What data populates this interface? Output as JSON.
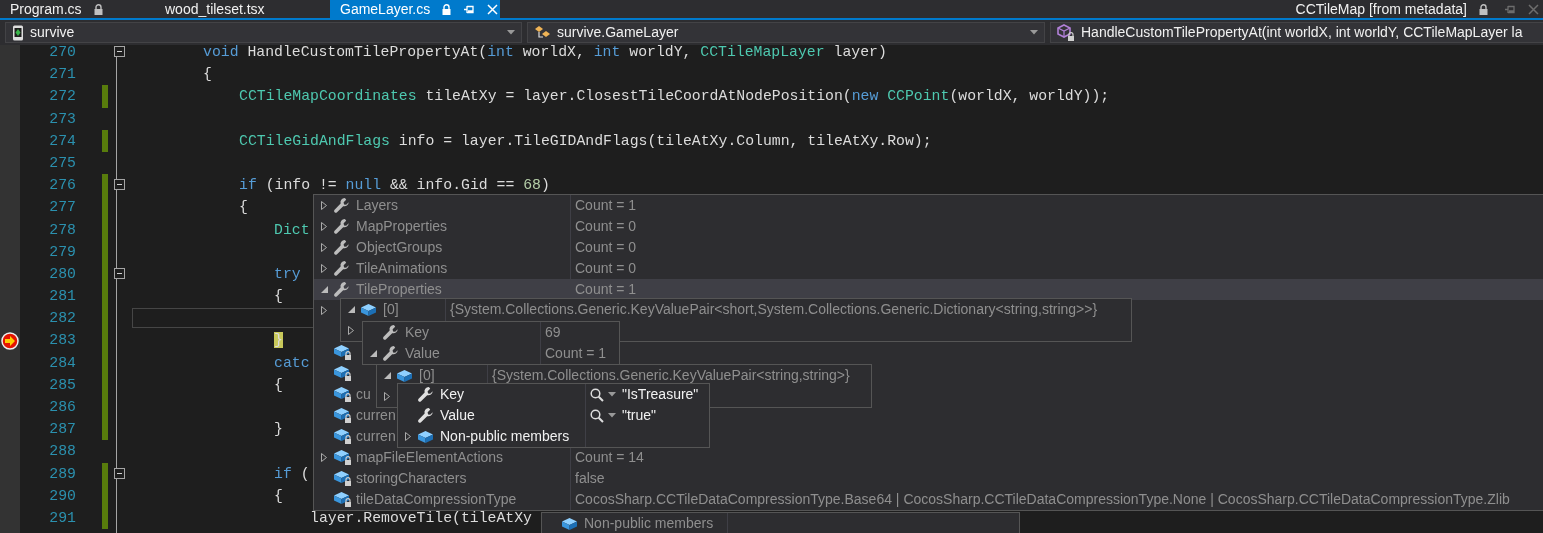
{
  "tabs": [
    {
      "label": "Program.cs",
      "kind": "doc",
      "selected": false,
      "locked": true
    },
    {
      "label": "wood_tileset.tsx",
      "kind": "doc",
      "selected": false,
      "locked": false
    },
    {
      "label": "GameLayer.cs",
      "kind": "doc",
      "selected": true,
      "locked": true
    },
    {
      "label": "CCTileMap [from metadata]",
      "kind": "preview",
      "selected": false,
      "locked": true
    }
  ],
  "navigation": {
    "project": "survive",
    "type": "survive.GameLayer",
    "member": "HandleCustomTilePropertyAt(int worldX, int worldY, CCTileMapLayer la"
  },
  "editor": {
    "lines": [
      {
        "number": "270",
        "changed": false,
        "foldable": true,
        "caret": false,
        "current_statement": false,
        "tokens": [
          {
            "text": "void",
            "kind": "keyword"
          },
          {
            "text": " HandleCustomTilePropertyAt(",
            "kind": "plain"
          },
          {
            "text": "int",
            "kind": "keyword"
          },
          {
            "text": " worldX, ",
            "kind": "plain"
          },
          {
            "text": "int",
            "kind": "keyword"
          },
          {
            "text": " worldY, ",
            "kind": "plain"
          },
          {
            "text": "CCTileMapLayer",
            "kind": "type"
          },
          {
            "text": " layer)",
            "kind": "plain"
          }
        ]
      },
      {
        "number": "271",
        "changed": false,
        "foldable": false,
        "caret": false,
        "current_statement": false,
        "tokens": [
          {
            "text": "{",
            "kind": "plain"
          }
        ],
        "children": [
          {
            "number": "272",
            "changed": true,
            "foldable": false,
            "caret": false,
            "current_statement": false,
            "tokens": [
              {
                "text": "CCTileMapCoordinates",
                "kind": "type"
              },
              {
                "text": " tileAtXy = layer.ClosestTileCoordAtNodePosition(",
                "kind": "plain"
              },
              {
                "text": "new",
                "kind": "keyword"
              },
              {
                "text": " CCPoint",
                "kind": "type"
              },
              {
                "text": "(worldX, worldY));",
                "kind": "plain"
              }
            ]
          },
          {
            "number": "273",
            "changed": false,
            "foldable": false,
            "caret": false,
            "current_statement": false
          },
          {
            "number": "274",
            "changed": true,
            "foldable": false,
            "caret": false,
            "current_statement": false,
            "tokens": [
              {
                "text": "CCTileGidAndFlags",
                "kind": "type"
              },
              {
                "text": " info = layer.TileGIDAndFlags(tileAtXy.Column, tileAtXy.Row);",
                "kind": "plain"
              }
            ]
          },
          {
            "number": "275",
            "changed": false,
            "foldable": false,
            "caret": false,
            "current_statement": false
          },
          {
            "number": "276",
            "changed": true,
            "foldable": true,
            "caret": false,
            "current_statement": false,
            "tokens": [
              {
                "text": "if",
                "kind": "keyword"
              },
              {
                "text": " (info != ",
                "kind": "plain"
              },
              {
                "text": "null",
                "kind": "keyword"
              },
              {
                "text": " && info.Gid == ",
                "kind": "plain"
              },
              {
                "text": "68",
                "kind": "number"
              },
              {
                "text": ")",
                "kind": "plain"
              }
            ]
          },
          {
            "number": "277",
            "changed": true,
            "foldable": false,
            "caret": false,
            "current_statement": false,
            "tokens": [
              {
                "text": "{",
                "kind": "plain"
              }
            ],
            "children": [
              {
                "number": "278",
                "changed": true,
                "foldable": false,
                "caret": false,
                "current_statement": false,
                "tokens": [
                  {
                    "text": "Dict",
                    "kind": "type"
                  }
                ]
              },
              {
                "number": "279",
                "changed": true,
                "foldable": false,
                "caret": false,
                "current_statement": false
              },
              {
                "number": "280",
                "changed": true,
                "foldable": true,
                "caret": false,
                "current_statement": false,
                "tokens": [
                  {
                    "text": "try",
                    "kind": "keyword"
                  }
                ]
              },
              {
                "number": "281",
                "changed": true,
                "foldable": false,
                "caret": false,
                "current_statement": false,
                "tokens": [
                  {
                    "text": "{",
                    "kind": "plain"
                  }
                ]
              },
              {
                "number": "282",
                "changed": true,
                "foldable": false,
                "caret": true,
                "current_statement": false
              },
              {
                "number": "283",
                "changed": true,
                "foldable": false,
                "caret": false,
                "current_statement": true,
                "tokens": [
                  {
                    "text": "}",
                    "kind": "plain"
                  }
                ]
              },
              {
                "number": "284",
                "changed": true,
                "foldable": false,
                "caret": false,
                "current_statement": false,
                "tokens": [
                  {
                    "text": "catc",
                    "kind": "keyword"
                  }
                ]
              },
              {
                "number": "285",
                "changed": true,
                "foldable": false,
                "caret": false,
                "current_statement": false,
                "tokens": [
                  {
                    "text": "{",
                    "kind": "plain"
                  }
                ]
              },
              {
                "number": "286",
                "changed": true,
                "foldable": false,
                "caret": false,
                "current_statement": false
              },
              {
                "number": "287",
                "changed": true,
                "foldable": false,
                "caret": false,
                "current_statement": false,
                "tokens": [
                  {
                    "text": "}",
                    "kind": "plain"
                  }
                ]
              },
              {
                "number": "288",
                "changed": false,
                "foldable": false,
                "caret": false,
                "current_statement": false
              },
              {
                "number": "289",
                "changed": true,
                "foldable": true,
                "caret": false,
                "current_statement": false,
                "tokens": [
                  {
                    "text": "if",
                    "kind": "keyword"
                  },
                  {
                    "text": " (",
                    "kind": "plain"
                  }
                ]
              },
              {
                "number": "290",
                "changed": true,
                "foldable": false,
                "caret": false,
                "current_statement": false,
                "tokens": [
                  {
                    "text": "{",
                    "kind": "plain"
                  }
                ],
                "children": [
                  {
                    "number": "291",
                    "changed": true,
                    "foldable": false,
                    "caret": false,
                    "current_statement": false,
                    "tokens": [
                      {
                        "text": "layer.RemoveTile(tileAtXy",
                        "kind": "plain"
                      }
                    ]
                  }
                ]
              }
            ]
          }
        ]
      }
    ]
  },
  "datatips": [
    {
      "active": false,
      "rows": [
        {
          "kind": "property",
          "expandable": true,
          "expanded": false,
          "name": "Layers",
          "value": "Count = 1",
          "selected": false
        },
        {
          "kind": "property",
          "expandable": true,
          "expanded": false,
          "name": "MapProperties",
          "value": "Count = 0",
          "selected": false
        },
        {
          "kind": "property",
          "expandable": true,
          "expanded": false,
          "name": "ObjectGroups",
          "value": "Count = 0",
          "selected": false
        },
        {
          "kind": "property",
          "expandable": true,
          "expanded": false,
          "name": "TileAnimations",
          "value": "Count = 0",
          "selected": false
        },
        {
          "kind": "property",
          "expandable": true,
          "expanded": true,
          "name": "TileProperties",
          "value": "Count = 1",
          "selected": true
        },
        {
          "kind": "hidden",
          "expandable": true,
          "expanded": false,
          "selected": false
        },
        {
          "kind": "field",
          "expandable": false,
          "selected": false
        },
        {
          "kind": "field",
          "expandable": false,
          "selected": false
        },
        {
          "kind": "field",
          "expandable": false,
          "name": "cu",
          "selected": false
        },
        {
          "kind": "field",
          "expandable": false,
          "name": "curren",
          "selected": false
        },
        {
          "kind": "field",
          "expandable": false,
          "name": "curren",
          "selected": false
        },
        {
          "kind": "field",
          "expandable": true,
          "expanded": false,
          "name": "mapFileElementActions",
          "value": "Count = 14",
          "selected": false
        },
        {
          "kind": "field",
          "expandable": false,
          "name": "storingCharacters",
          "value": "false",
          "selected": false
        },
        {
          "kind": "field",
          "expandable": false,
          "name": "tileDataCompressionType",
          "value": "CocosSharp.CCTileDataCompressionType.Base64 | CocosSharp.CCTileDataCompressionType.None | CocosSharp.CCTileDataCompressionType.Zlib",
          "selected": false
        }
      ]
    },
    {
      "active": false,
      "rows": [
        {
          "kind": "object",
          "expandable": true,
          "expanded": true,
          "name": "[0]",
          "value": "{System.Collections.Generic.KeyValuePair<short,System.Collections.Generic.Dictionary<string,string>>}"
        },
        {
          "kind": "hidden",
          "expandable": true,
          "expanded": false
        }
      ]
    },
    {
      "active": false,
      "rows": [
        {
          "kind": "property",
          "expandable": false,
          "name": "Key",
          "value": "69"
        },
        {
          "kind": "property",
          "expandable": true,
          "expanded": true,
          "name": "Value",
          "value": "Count = 1"
        }
      ]
    },
    {
      "active": false,
      "rows": [
        {
          "kind": "object",
          "expandable": true,
          "expanded": true,
          "name": "[0]",
          "value": "{System.Collections.Generic.KeyValuePair<string,string>}"
        },
        {
          "kind": "hidden",
          "expandable": true,
          "expanded": false
        }
      ]
    },
    {
      "active": true,
      "rows": [
        {
          "kind": "string",
          "expandable": false,
          "name": "Key",
          "value": "\"IsTreasure\""
        },
        {
          "kind": "string",
          "expandable": false,
          "name": "Value",
          "value": "\"true\""
        },
        {
          "kind": "object",
          "expandable": true,
          "expanded": false,
          "name": "Non-public members"
        }
      ]
    },
    {
      "active": false,
      "rows": [
        {
          "kind": "object",
          "expandable": false,
          "name": "Non-public members"
        }
      ]
    }
  ]
}
